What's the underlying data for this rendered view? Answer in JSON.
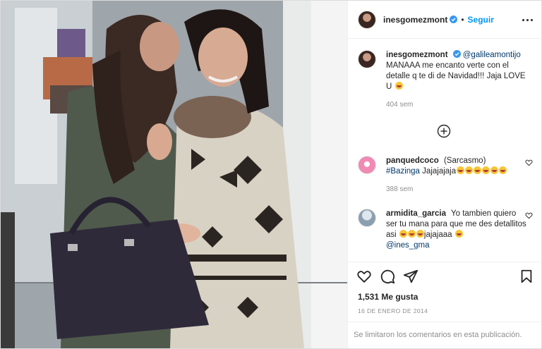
{
  "post": {
    "author": "inesgomezmont",
    "follow_label": "Seguir",
    "separator": "•"
  },
  "caption": {
    "username": "inesgomezmont",
    "mention": "@galileamontijo",
    "text": "MANAAA me encanto verte con el detalle q te di de Navidad!!! Jaja LOVE U",
    "time": "404 sem"
  },
  "comments": [
    {
      "username": "panquedcoco",
      "text": "(Sarcasmo)",
      "hashtag": "#Bazinga",
      "tail": "Jajajajaja",
      "time": "388 sem"
    },
    {
      "username": "armidita_garcia",
      "text": "Yo tambien quiero ser tu mana para que me des detallitos asi",
      "tail": "jajajaaa",
      "mention": "@ines_gma"
    }
  ],
  "likes_label": "1,531 Me gusta",
  "date_label": "16 DE ENERO DE 2014",
  "comments_limited_label": "Se limitaron los comentarios en esta publicación.",
  "icons": {
    "heart": "heart-icon",
    "comment": "comment-icon",
    "share": "paper-plane-icon",
    "save": "bookmark-icon",
    "more": "more-options-icon",
    "plus": "plus-circle-icon",
    "verified": "verified-badge-icon"
  },
  "colors": {
    "accent": "#0095f6",
    "link": "#00376b",
    "muted": "#8e8e8e",
    "verified": "#3897f0"
  }
}
